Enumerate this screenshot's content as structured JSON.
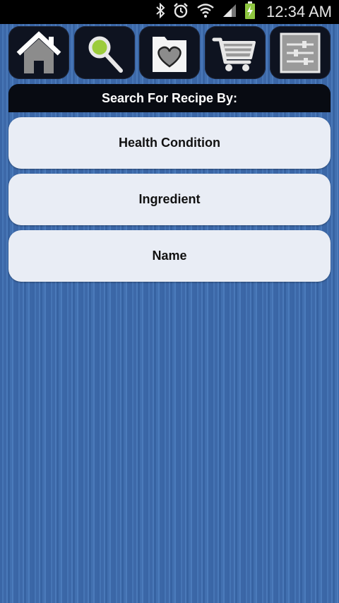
{
  "status_bar": {
    "time": "12:34 AM",
    "icons": [
      "bluetooth-icon",
      "alarm-icon",
      "wifi-icon",
      "signal-icon",
      "battery-charging-icon"
    ]
  },
  "toolbar": {
    "buttons": [
      {
        "icon": "home-icon"
      },
      {
        "icon": "search-icon"
      },
      {
        "icon": "favorites-folder-icon"
      },
      {
        "icon": "shopping-cart-icon"
      },
      {
        "icon": "settings-sliders-icon"
      }
    ]
  },
  "search": {
    "header": "Search For Recipe By:",
    "options": [
      "Health Condition",
      "Ingredient",
      "Name"
    ]
  },
  "colors": {
    "background": "#3f6cab",
    "toolbar_button": "#0e1320",
    "option_button": "#e9edf5",
    "search_accent": "#9ccc3c"
  }
}
